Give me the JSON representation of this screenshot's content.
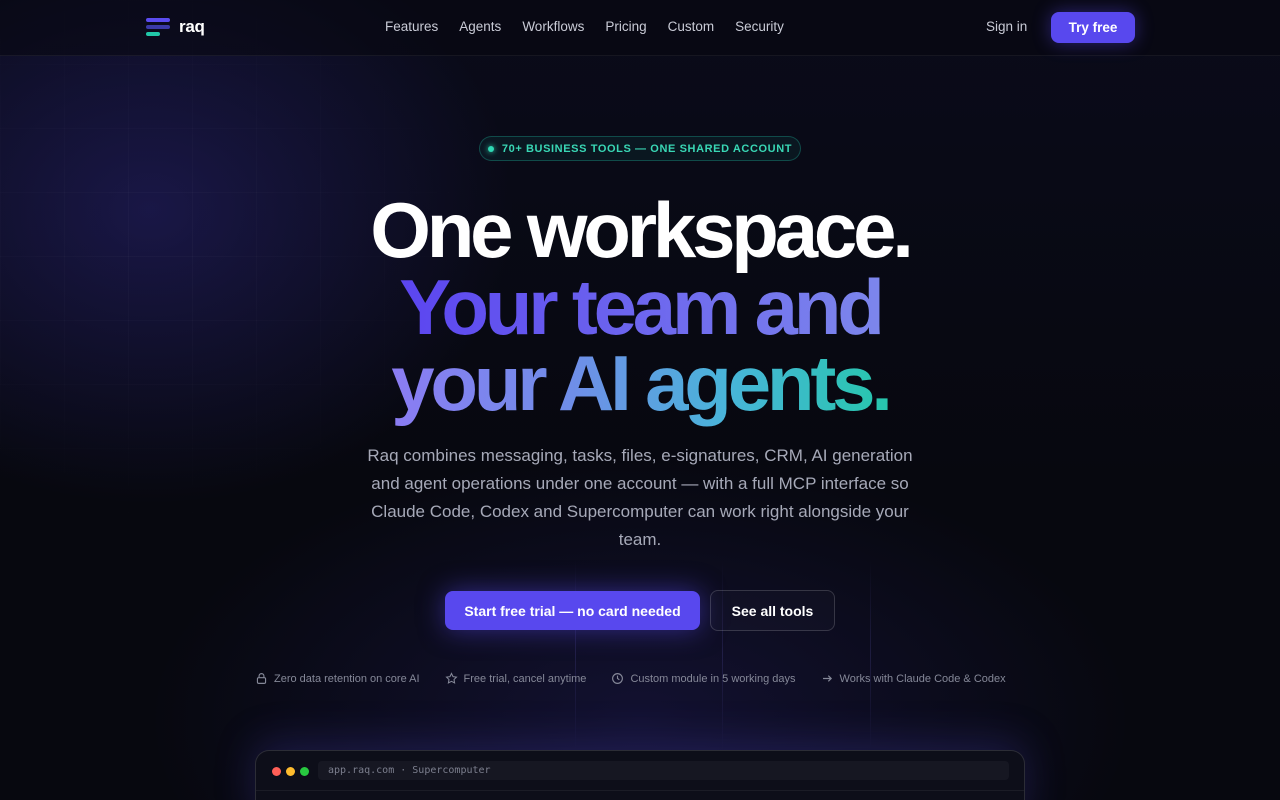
{
  "brand": {
    "name": "raq"
  },
  "nav": {
    "links": [
      "Features",
      "Agents",
      "Workflows",
      "Pricing",
      "Custom",
      "Security"
    ],
    "sign_in": "Sign in",
    "try_free": "Try free"
  },
  "hero": {
    "badge": "70+ BUSINESS TOOLS — ONE SHARED ACCOUNT",
    "headline_line1": "One workspace.",
    "headline_line2": "Your team and",
    "headline_line3_a": "your AI",
    "headline_line3_b": "agents.",
    "description": "Raq combines messaging, tasks, files, e-signatures, CRM, AI generation and agent operations under one account — with a full MCP interface so Claude Code, Codex and Supercomputer can work right alongside your team.",
    "cta_primary": "Start free trial — no card needed",
    "cta_secondary": "See all tools"
  },
  "features": [
    {
      "icon": "lock-icon",
      "label": "Zero data retention on core AI"
    },
    {
      "icon": "star-icon",
      "label": "Free trial, cancel anytime"
    },
    {
      "icon": "clock-icon",
      "label": "Custom module in 5 working days"
    },
    {
      "icon": "arrow-right-icon",
      "label": "Works with Claude Code & Codex"
    }
  ],
  "preview": {
    "url": "app.raq.com · Supercomputer"
  },
  "colors": {
    "accent": "#5848ee",
    "teal": "#21c7a8",
    "background": "#07080f"
  }
}
